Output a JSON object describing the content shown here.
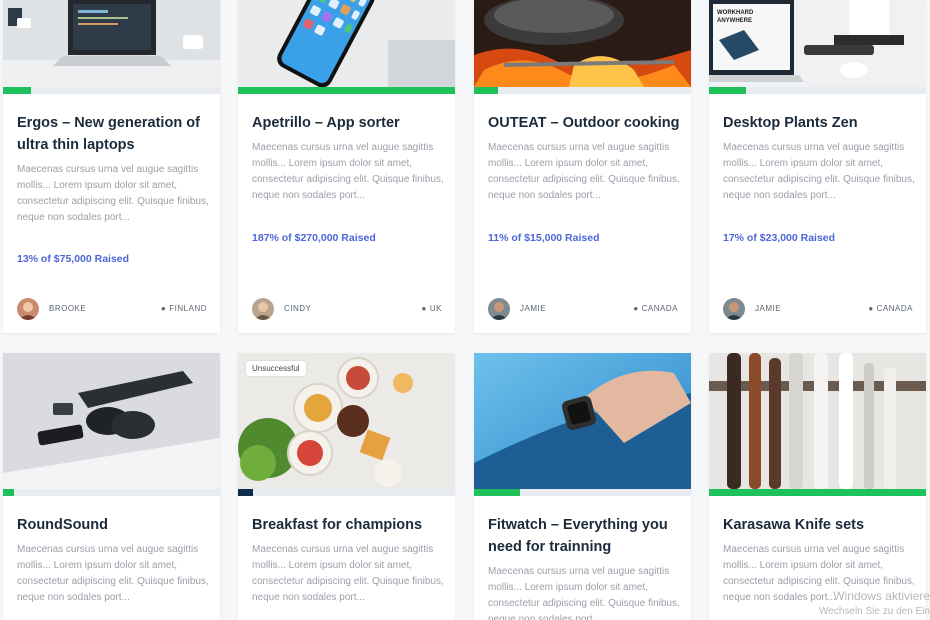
{
  "cards": [
    {
      "title": "Ergos – New generation of ultra thin laptops",
      "desc": "Maecenas cursus urna vel augue sagittis mollis... Lorem ipsum dolor sit amet, consectetur adipiscing elit. Quisque finibus, neque non sodales port...",
      "raised": "13% of $75,000 Raised",
      "progress": 0.13,
      "author": "BROOKE",
      "location": "FINLAND",
      "image": "laptop-desk-image"
    },
    {
      "title": "Apetrillo – App sorter",
      "desc": "Maecenas cursus urna vel augue sagittis mollis... Lorem ipsum dolor sit amet, consectetur adipiscing elit. Quisque finibus, neque non sodales port...",
      "raised": "187% of $270,000 Raised",
      "progress": 1.0,
      "author": "CINDY",
      "location": "UK",
      "image": "smartphone-image"
    },
    {
      "title": "OUTEAT – Outdoor cooking",
      "desc": "Maecenas cursus urna vel augue sagittis mollis... Lorem ipsum dolor sit amet, consectetur adipiscing elit. Quisque finibus, neque non sodales port...",
      "raised": "11% of $15,000 Raised",
      "progress": 0.11,
      "author": "JAMIE",
      "location": "CANADA",
      "image": "campfire-pot-image"
    },
    {
      "title": "Desktop Plants Zen",
      "desc": "Maecenas cursus urna vel augue sagittis mollis... Lorem ipsum dolor sit amet, consectetur adipiscing elit. Quisque finibus, neque non sodales port...",
      "raised": "17% of $23,000 Raised",
      "progress": 0.17,
      "author": "JAMIE",
      "location": "CANADA",
      "image": "desk-plant-laptop-image"
    },
    {
      "title": "RoundSound",
      "desc": "Maecenas cursus urna vel augue sagittis mollis... Lorem ipsum dolor sit amet, consectetur adipiscing elit. Quisque finibus, neque non sodales port...",
      "progress": 0.05,
      "image": "headphones-desk-image"
    },
    {
      "title": "Breakfast for champions",
      "desc": "Maecenas cursus urna vel augue sagittis mollis... Lorem ipsum dolor sit amet, consectetur adipiscing elit. Quisque finibus, neque non sodales port...",
      "badge": "Unsuccessful",
      "progress": 0.07,
      "image": "breakfast-table-image"
    },
    {
      "title": "Fitwatch – Everything you need for trainning",
      "desc": "Maecenas cursus urna vel augue sagittis mollis... Lorem ipsum dolor sit amet, consectetur adipiscing elit. Quisque finibus, neque non sodales port...",
      "progress": 0.21,
      "image": "smartwatch-wrist-image"
    },
    {
      "title": "Karasawa Knife sets",
      "desc": "Maecenas cursus urna vel augue sagittis mollis... Lorem ipsum dolor sit amet, consectetur adipiscing elit. Quisque finibus, neque non sodales port...",
      "progress": 1.0,
      "image": "knife-rack-image"
    }
  ],
  "watermark": {
    "line1": "Windows aktiviere",
    "line2": "Wechseln Sie zu den Ein"
  },
  "colors": {
    "progress": "#1ec25a",
    "progress_dark": "#0f2c4d",
    "raised": "#4e67d7",
    "title": "#1b2b3c"
  }
}
